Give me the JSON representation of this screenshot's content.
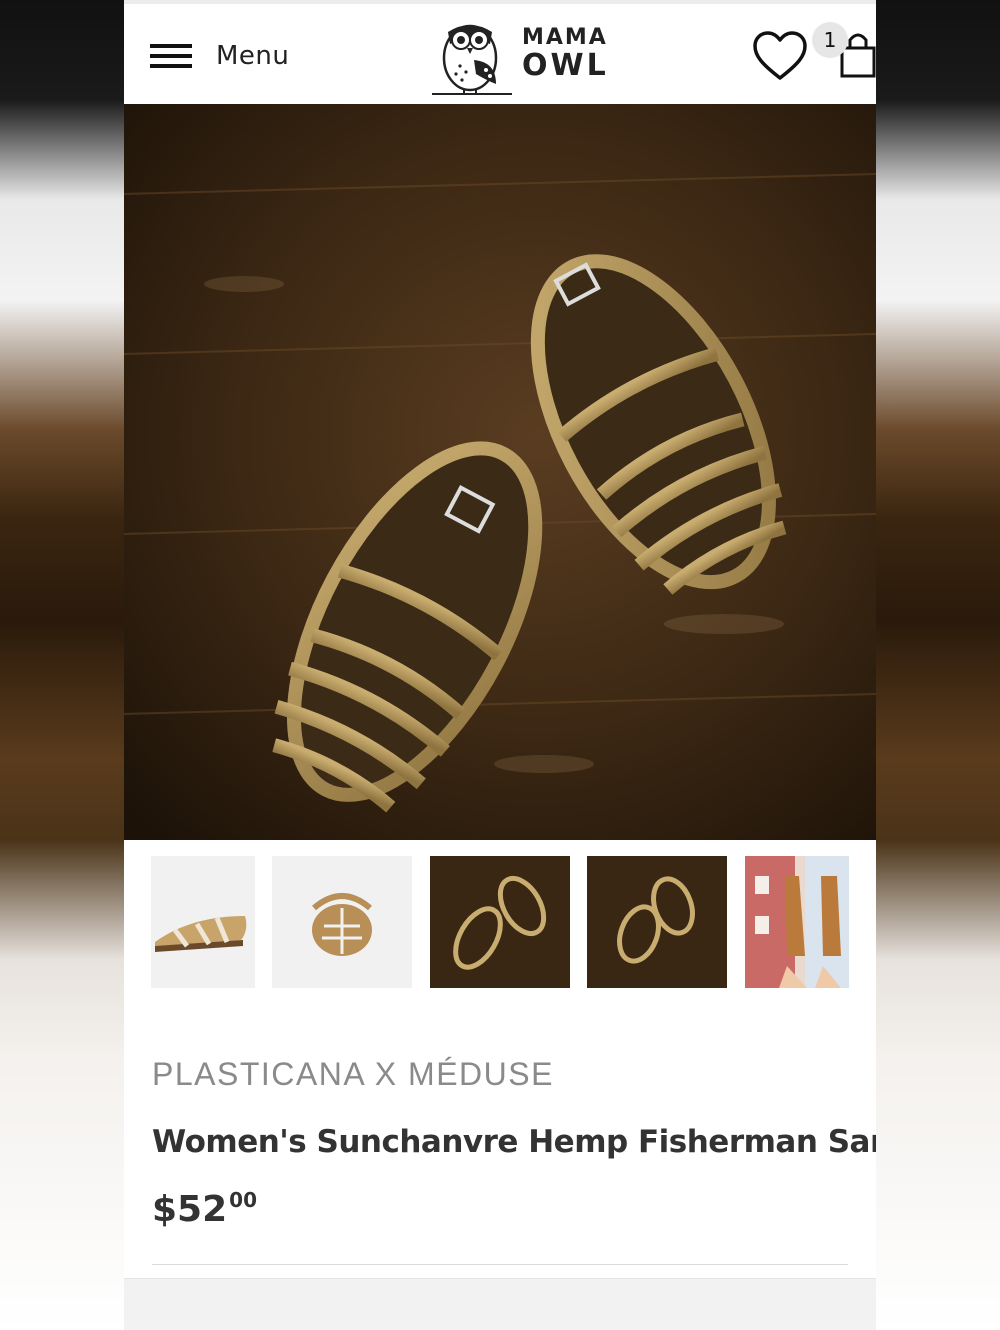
{
  "header": {
    "menu_label": "Menu",
    "logo_line1": "MAMA",
    "logo_line2": "OWL",
    "cart_count": "1"
  },
  "gallery": {
    "thumbnails": [
      {
        "label": "sandal side view"
      },
      {
        "label": "sandal front view"
      },
      {
        "label": "sandals on wood top view"
      },
      {
        "label": "sandals on wood angled view"
      },
      {
        "label": "sandals worn on feet"
      }
    ]
  },
  "product": {
    "brand": "PLASTICANA X MÉDUSE",
    "title": "Women's Sunchanvre Hemp Fisherman Sandals",
    "price_main": "$52",
    "price_cents": "00"
  },
  "colors": {
    "background": "#ffffff",
    "text": "#333333",
    "brand_text": "#8a8a8a",
    "wood_dark": "#2e1f10",
    "sandal_amber": "#b89a5c"
  }
}
